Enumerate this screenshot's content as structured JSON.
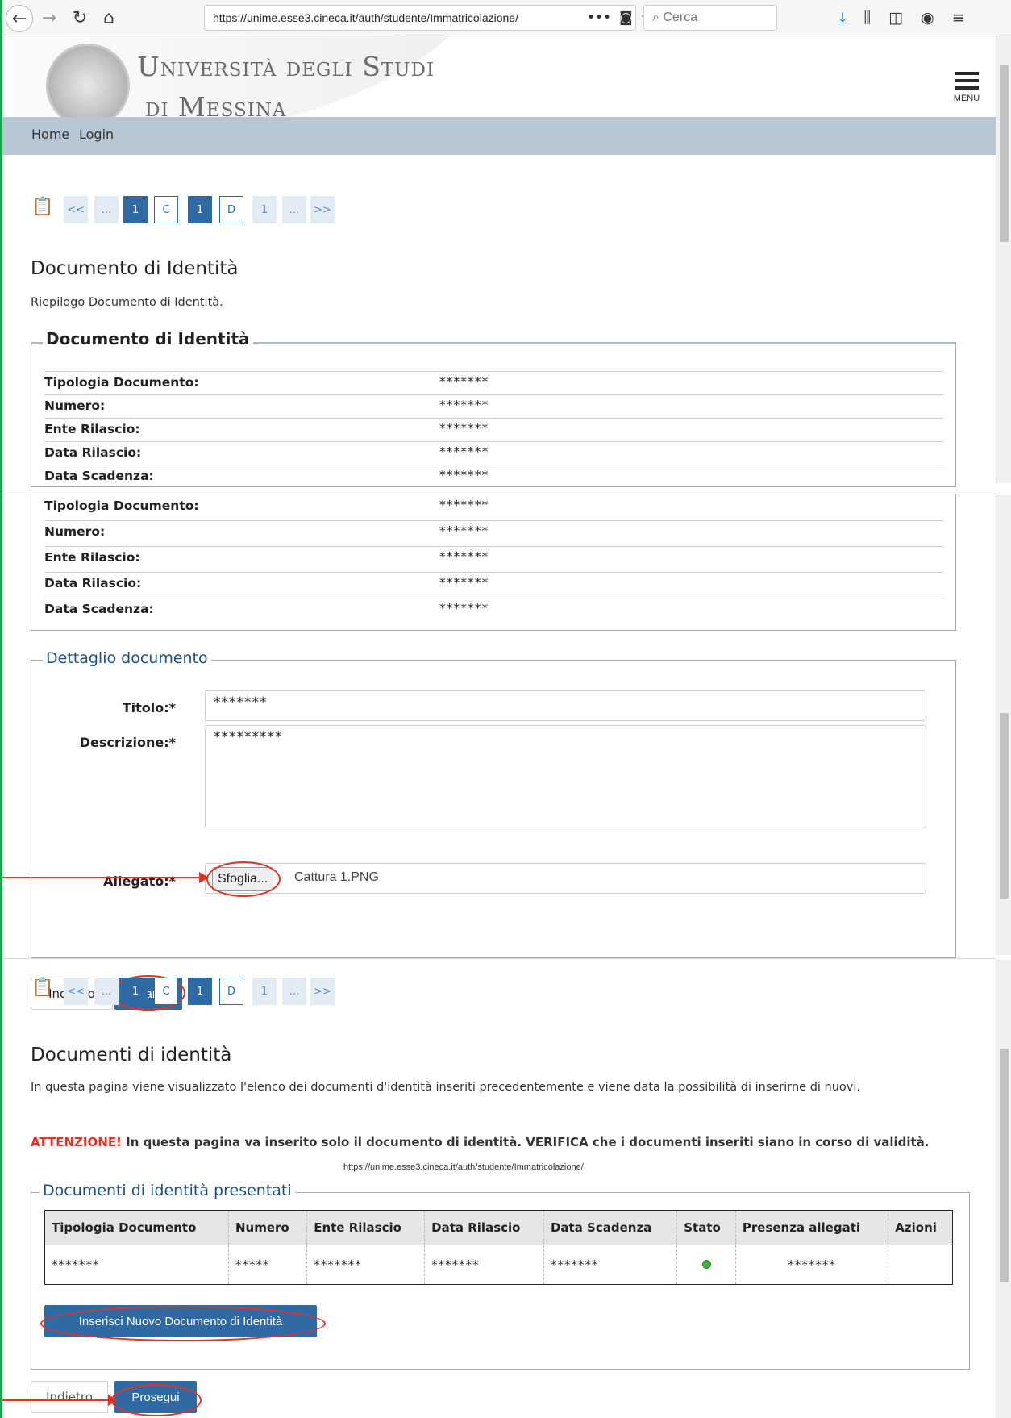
{
  "browser": {
    "url": "https://unime.esse3.cineca.it/auth/studente/Immatricolazione/",
    "url_suffix": "•••",
    "search_placeholder": "Cerca"
  },
  "header": {
    "university_line1": "Università degli Studi",
    "university_line2": "di Messina",
    "menu_label": "MENU"
  },
  "nav": {
    "home": "Home",
    "login": "Login"
  },
  "stepper": [
    "<<",
    "...",
    "1",
    "C",
    "1",
    "D",
    "1",
    "...",
    ">>"
  ],
  "identity_summary": {
    "title": "Documento di Identità",
    "subtitle": "Riepilogo Documento di Identità.",
    "legend": "Documento di Identità",
    "rows": [
      {
        "label": "Tipologia Documento:",
        "value": "*******"
      },
      {
        "label": "Numero:",
        "value": "*******"
      },
      {
        "label": "Ente Rilascio:",
        "value": "*******"
      },
      {
        "label": "Data Rilascio:",
        "value": "*******"
      },
      {
        "label": "Data Scadenza:",
        "value": "*******"
      }
    ]
  },
  "detail": {
    "legend": "Dettaglio documento",
    "titolo_label": "Titolo:*",
    "titolo_value": "*******",
    "descrizione_label": "Descrizione:*",
    "descrizione_value": "*********",
    "allegato_label": "Allegato:*",
    "browse_button": "Sfoglia...",
    "file_name": "Cattura 1.PNG"
  },
  "form_buttons": {
    "back": "Indietro",
    "next": "Avanti"
  },
  "documents_page": {
    "title": "Documenti di identità",
    "intro": "In questa pagina viene visualizzato l'elenco dei documenti d'identità inseriti precedentemente e viene data la possibilità di inserirne di nuovi.",
    "warning_prefix": "ATTENZIONE!",
    "warning_text": " In questa pagina va inserito solo il documento di identità. VERIFICA che i documenti inseriti siano in corso di validità.",
    "url_note": "https://unime.esse3.cineca.it/auth/studente/Immatricolazione/",
    "legend": "Documenti di identità presentati",
    "columns": [
      "Tipologia Documento",
      "Numero",
      "Ente Rilascio",
      "Data Rilascio",
      "Data Scadenza",
      "Stato",
      "Presenza allegati",
      "Azioni"
    ],
    "row": [
      "*******",
      "*****",
      "*******",
      "*******",
      "*******",
      "",
      "*******",
      ""
    ],
    "insert_button": "Inserisci Nuovo Documento di Identità",
    "back_button": "Indietro",
    "continue_button": "Prosegui"
  },
  "colors": {
    "accent": "#2f6aa4",
    "nav_band": "#b8c7d4",
    "annotation": "#e53222",
    "status_ok": "#43b33e"
  }
}
